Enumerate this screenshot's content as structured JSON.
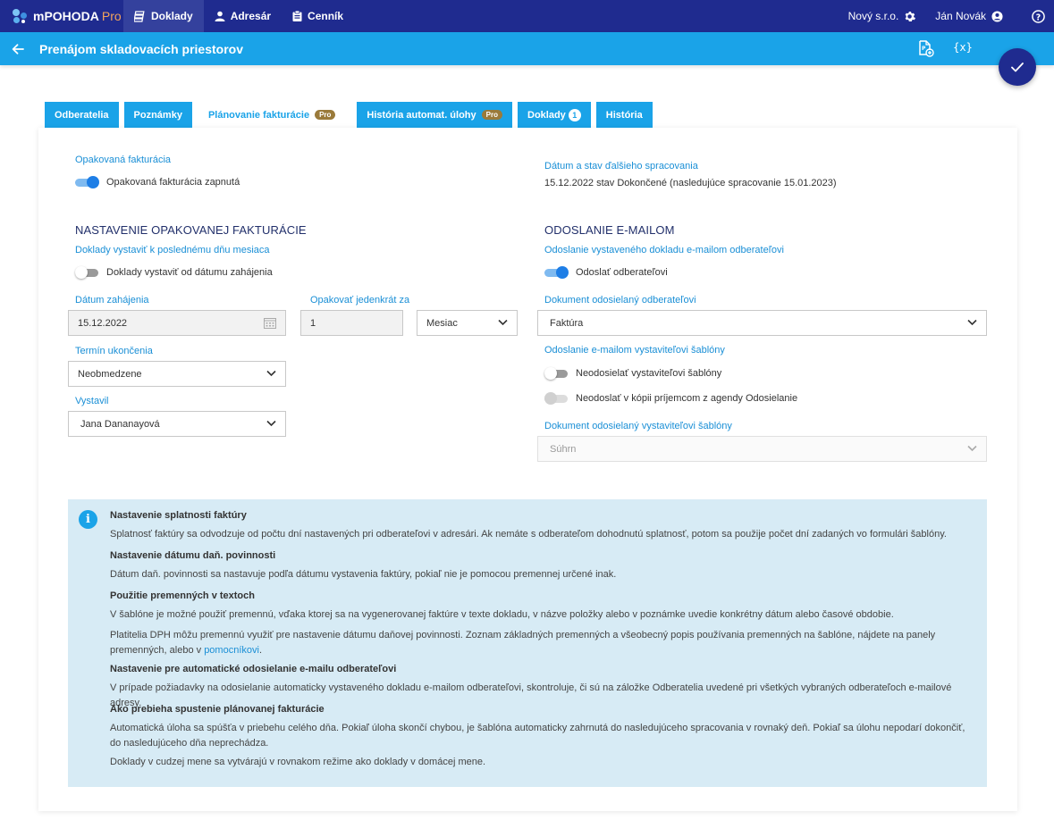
{
  "topbar": {
    "app_name": "mPOHODA",
    "app_pro": "Pro",
    "nav": [
      {
        "label": "Doklady",
        "icon": "stack-icon",
        "active": true
      },
      {
        "label": "Adresár",
        "icon": "person-icon",
        "active": false
      },
      {
        "label": "Cenník",
        "icon": "clipboard-icon",
        "active": false
      }
    ],
    "company": "Nový s.r.o.",
    "user": "Ján Novák"
  },
  "header": {
    "title": "Prenájom skladovacích priestorov"
  },
  "tabs": [
    {
      "label": "Odberatelia",
      "active": false
    },
    {
      "label": "Poznámky",
      "active": false
    },
    {
      "label": "Plánovanie fakturácie",
      "badge": "Pro",
      "active": true
    },
    {
      "label": "História automat. úlohy",
      "badge": "Pro",
      "active": false
    },
    {
      "label": "Doklady",
      "count": "1",
      "active": false
    },
    {
      "label": "História",
      "active": false
    }
  ],
  "recurring": {
    "label": "Opakovaná fakturácia",
    "toggle_label": "Opakovaná fakturácia zapnutá",
    "toggle_on": true
  },
  "next_processing": {
    "label": "Dátum a stav ďalšieho spracovania",
    "value": "15.12.2022 stav Dokončené (nasledujúce spracovanie 15.01.2023)"
  },
  "settings": {
    "heading": "NASTAVENIE OPAKOVANEJ FAKTURÁCIE",
    "last_day_label": "Doklady vystaviť k poslednému dňu mesiaca",
    "from_start_label": "Doklady vystaviť od dátumu zahájenia",
    "from_start_on": false,
    "start_date_label": "Dátum zahájenia",
    "start_date_value": "15.12.2022",
    "repeat_label": "Opakovať jedenkrát za",
    "repeat_value": "1",
    "repeat_unit": "Mesiac",
    "end_label": "Termín ukončenia",
    "end_value": "Neobmedzene",
    "issuer_label": "Vystavil",
    "issuer_value": "Jana Dananayová"
  },
  "email": {
    "heading": "ODOSLANIE E-MAILOM",
    "send_label": "Odoslanie vystaveného dokladu e-mailom odberateľovi",
    "send_toggle_label": "Odoslať odberateľovi",
    "send_on": true,
    "doc_label": "Dokument odosielaný odberateľovi",
    "doc_value": "Faktúra",
    "issuer_send_label": "Odoslanie e-mailom vystaviteľovi šablóny",
    "no_send_issuer_label": "Neodosielať vystaviteľovi šablóny",
    "no_send_issuer_on": false,
    "no_copy_label": "Neodoslať v kópii príjemcom z agendy Odosielanie",
    "no_copy_on": false,
    "issuer_doc_label": "Dokument odosielaný vystaviteľovi šablóny",
    "issuer_doc_value": "Súhrn"
  },
  "info": {
    "h1": "Nastavenie splatnosti faktúry",
    "p1": "Splatnosť faktúry sa odvodzuje od počtu dní nastavených pri odberateľovi v adresári. Ak nemáte s odberateľom dohodnutú splatnosť, potom sa použije počet dní zadaných vo formulári šablóny.",
    "h2": "Nastavenie dátumu daň. povinnosti",
    "p2": "Dátum daň. povinnosti sa nastavuje podľa dátumu vystavenia faktúry, pokiaľ nie je pomocou premennej určené inak.",
    "h3": "Použitie premenných v textoch",
    "p3": "V šablóne je možné použiť premennú, vďaka ktorej sa na vygenerovanej faktúre v texte dokladu, v názve položky alebo v poznámke uvedie konkrétny dátum alebo časové obdobie.",
    "p4": "Platitelia DPH môžu premennú využiť pre nastavenie dátumu daňovej povinnosti. Zoznam základných premenných a všeobecný popis používania premenných na šablóne, nájdete na panely premenných, alebo v",
    "p4_link": "pomocníkovi",
    "p4_end": ".",
    "h4": "Nastavenie pre automatické odosielanie e-mailu odberateľovi",
    "p5": "V prípade požiadavky na odosielanie automaticky vystaveného dokladu e-mailom odberateľovi, skontroluje, či sú na záložke Odberatelia uvedené pri všetkých vybraných odberateľoch e-mailové adresy.",
    "h5": "Ako prebieha spustenie plánovanej fakturácie",
    "p6": "Automatická úloha sa spúšťa v priebehu celého dňa. Pokiaľ úloha skončí chybou, je šablóna automaticky zahrnutá do nasledujúceho spracovania v rovnaký deň. Pokiaľ sa úlohu nepodarí dokončiť, do nasledujúceho dňa neprechádza.",
    "p7": "Doklady v cudzej mene sa vytvárajú v rovnakom režime ako doklady v domácej mene."
  }
}
